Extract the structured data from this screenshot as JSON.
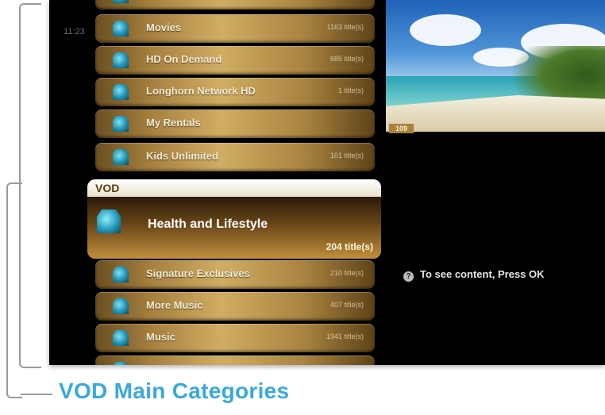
{
  "screen": {
    "time": "11:23",
    "menu_above": [
      {
        "label": "Movies",
        "count": "1163 title(s)"
      },
      {
        "label": "HD On Demand",
        "count": "685 title(s)"
      },
      {
        "label": "Longhorn Network HD",
        "count": "1 title(s)"
      },
      {
        "label": "My Rentals",
        "count": ""
      },
      {
        "label": "Kids Unlimited",
        "count": "101 title(s)"
      }
    ],
    "selected": {
      "header": "VOD",
      "label": "Health and Lifestyle",
      "count": "204 title(s)"
    },
    "menu_below": [
      {
        "label": "Signature Exclusives",
        "count": "210 title(s)"
      },
      {
        "label": "More Music",
        "count": "407 title(s)"
      },
      {
        "label": "Music",
        "count": "1941 title(s)"
      }
    ],
    "preview": {
      "channel": "109"
    },
    "hint": {
      "icon": "info-icon",
      "text": "To see content, Press OK"
    }
  },
  "caption": "VOD Main Categories",
  "colors": {
    "caption": "#39a9dc",
    "bracket": "#9a9a9a",
    "item_gold": "#c79b42"
  }
}
